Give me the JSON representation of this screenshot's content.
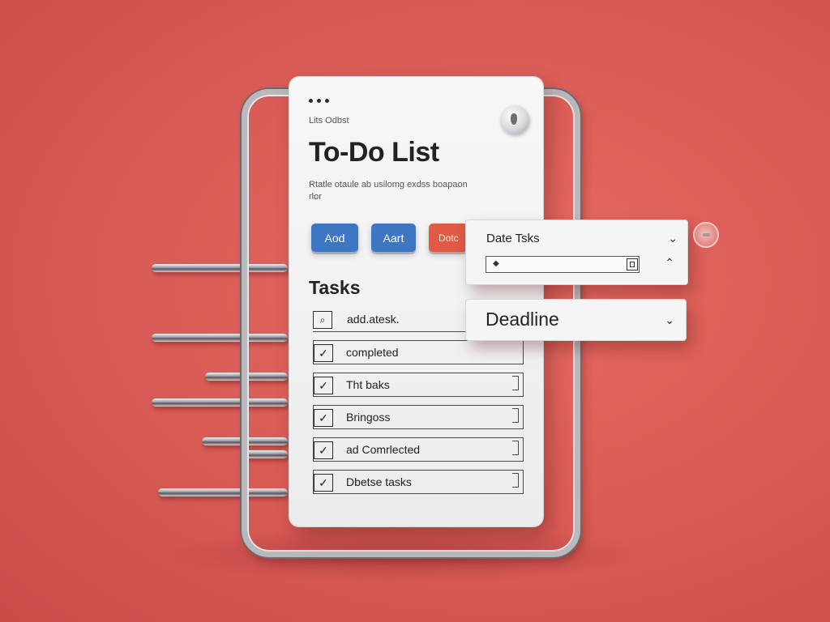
{
  "panel": {
    "subtitle": "Lits Odbst",
    "title": "To-Do List",
    "description": "Rtatle otaule ab usilomg exdss boapaon rlor",
    "buttons": {
      "add_label": "Aod",
      "alert_label": "Aart",
      "date_label": "Dotc"
    },
    "tasks_heading": "Tasks",
    "tasks": [
      {
        "label": "add.atesk.",
        "check": ""
      },
      {
        "label": "completed",
        "check": "✓"
      },
      {
        "label": "Tht baks",
        "check": "✓"
      },
      {
        "label": "Bringoss",
        "check": "✓"
      },
      {
        "label": "ad Comrlected",
        "check": "✓"
      },
      {
        "label": "Dbetse tasks",
        "check": "✓"
      }
    ]
  },
  "date_dropdown": {
    "label": "Date Tsks",
    "input_value": "",
    "chevron_down": "⌄",
    "chevron_up": "⌃"
  },
  "deadline_dropdown": {
    "label": "Deadline",
    "chevron_down": "⌄"
  },
  "colors": {
    "background": "#d85a54",
    "button_blue": "#3f76c4",
    "button_red": "#e05a45",
    "panel": "#f3f3f4"
  }
}
